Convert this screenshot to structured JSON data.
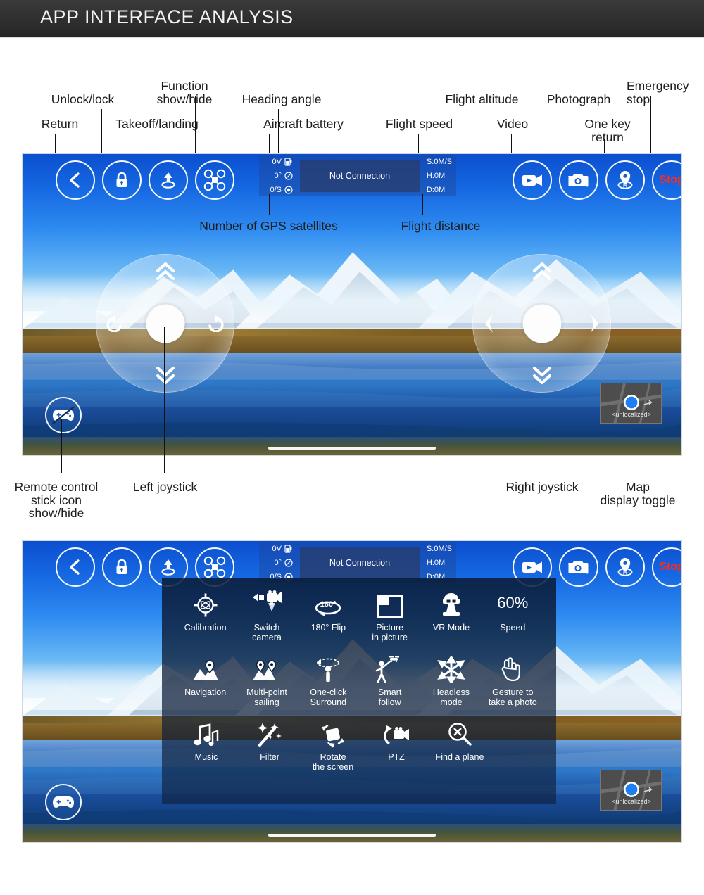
{
  "header": {
    "title": "APP INTERFACE ANALYSIS"
  },
  "colors": {
    "header_bg": "#2f2f2f",
    "header_text": "#f2f2f2",
    "stop_text": "#ff2a20",
    "hud_accent": "#ffffff",
    "callout_text": "#1d1d1d"
  },
  "callouts_top": [
    {
      "text": "Return",
      "name": "callout-return"
    },
    {
      "text": "Unlock/lock",
      "name": "callout-unlock-lock"
    },
    {
      "text": "Takeoff/landing",
      "name": "callout-takeoff-landing"
    },
    {
      "text": "Function\nshow/hide",
      "name": "callout-function-show-hide"
    },
    {
      "text": "Heading angle",
      "name": "callout-heading-angle"
    },
    {
      "text": "Aircraft battery",
      "name": "callout-aircraft-battery"
    },
    {
      "text": "Flight speed",
      "name": "callout-flight-speed"
    },
    {
      "text": "Flight altitude",
      "name": "callout-flight-altitude"
    },
    {
      "text": "Video",
      "name": "callout-video"
    },
    {
      "text": "Photograph",
      "name": "callout-photograph"
    },
    {
      "text": "One key\nreturn",
      "name": "callout-one-key-return"
    },
    {
      "text": "Emergency\nstop",
      "name": "callout-emergency-stop"
    }
  ],
  "callouts_mid": [
    {
      "text": "Number of GPS satellites",
      "name": "callout-gps-satellites"
    },
    {
      "text": "Flight distance",
      "name": "callout-flight-distance"
    }
  ],
  "callouts_bottom": [
    {
      "text": "Remote control\nstick icon\nshow/hide",
      "name": "callout-remote-control-stick-toggle"
    },
    {
      "text": "Left joystick",
      "name": "callout-left-joystick"
    },
    {
      "text": "Right joystick",
      "name": "callout-right-joystick"
    },
    {
      "text": "Map\ndisplay toggle",
      "name": "callout-map-display-toggle"
    }
  ],
  "hud": {
    "left_buttons": [
      {
        "name": "return-button",
        "icon": "chevron-left-icon",
        "label": "Return"
      },
      {
        "name": "lock-button",
        "icon": "lock-icon",
        "label": "Unlock/lock"
      },
      {
        "name": "takeoff-landing-button",
        "icon": "takeoff-landing-icon",
        "label": "Takeoff/landing"
      },
      {
        "name": "function-toggle-button",
        "icon": "drone-icon",
        "label": "Function show/hide"
      }
    ],
    "right_buttons": [
      {
        "name": "video-button",
        "icon": "video-camera-icon",
        "label": "Video"
      },
      {
        "name": "photo-button",
        "icon": "photo-camera-icon",
        "label": "Photograph"
      },
      {
        "name": "one-key-return-button",
        "icon": "home-pin-icon",
        "label": "One key return"
      },
      {
        "name": "emergency-stop-button",
        "icon": "stop-text-icon",
        "label": "Stop"
      }
    ],
    "status": {
      "battery": {
        "value": "0V",
        "icon": "battery-icon"
      },
      "heading": {
        "value": "0°",
        "icon": "compass-icon"
      },
      "satellites": {
        "value": "0/S",
        "icon": "satellite-icon"
      },
      "connection": "Not Connection",
      "speed": "S:0M/S",
      "height": "H:0M",
      "distance": "D:0M"
    },
    "minimap_label": "<unlocalized>",
    "stick_toggle": {
      "name": "stick-toggle-button",
      "icon": "gamepad-off-icon"
    },
    "stick_toggle_on": {
      "name": "stick-toggle-button",
      "icon": "gamepad-icon"
    }
  },
  "menu": {
    "rows": [
      [
        {
          "label": "Calibration",
          "icon": "calibration-icon"
        },
        {
          "label": "Switch\ncamera",
          "icon": "switch-camera-icon"
        },
        {
          "label": "180° Flip",
          "icon": "flip-180-icon"
        },
        {
          "label": "Picture\nin picture",
          "icon": "picture-in-picture-icon"
        },
        {
          "label": "VR Mode",
          "icon": "vr-mode-icon"
        },
        {
          "label": "Speed",
          "icon": "speed-value",
          "value": "60%"
        }
      ],
      [
        {
          "label": "Navigation",
          "icon": "navigation-icon"
        },
        {
          "label": "Multi-point\nsailing",
          "icon": "multi-point-sailing-icon"
        },
        {
          "label": "One-click\nSurround",
          "icon": "one-click-surround-icon"
        },
        {
          "label": "Smart\nfollow",
          "icon": "smart-follow-icon"
        },
        {
          "label": "Headless\nmode",
          "icon": "headless-mode-icon"
        },
        {
          "label": "Gesture to\ntake a photo",
          "icon": "gesture-photo-icon"
        }
      ],
      [
        {
          "label": "Music",
          "icon": "music-icon"
        },
        {
          "label": "Filter",
          "icon": "filter-wand-icon"
        },
        {
          "label": "Rotate\nthe screen",
          "icon": "rotate-screen-icon"
        },
        {
          "label": "PTZ",
          "icon": "ptz-icon"
        },
        {
          "label": "Find a plane",
          "icon": "find-plane-icon"
        }
      ]
    ]
  }
}
